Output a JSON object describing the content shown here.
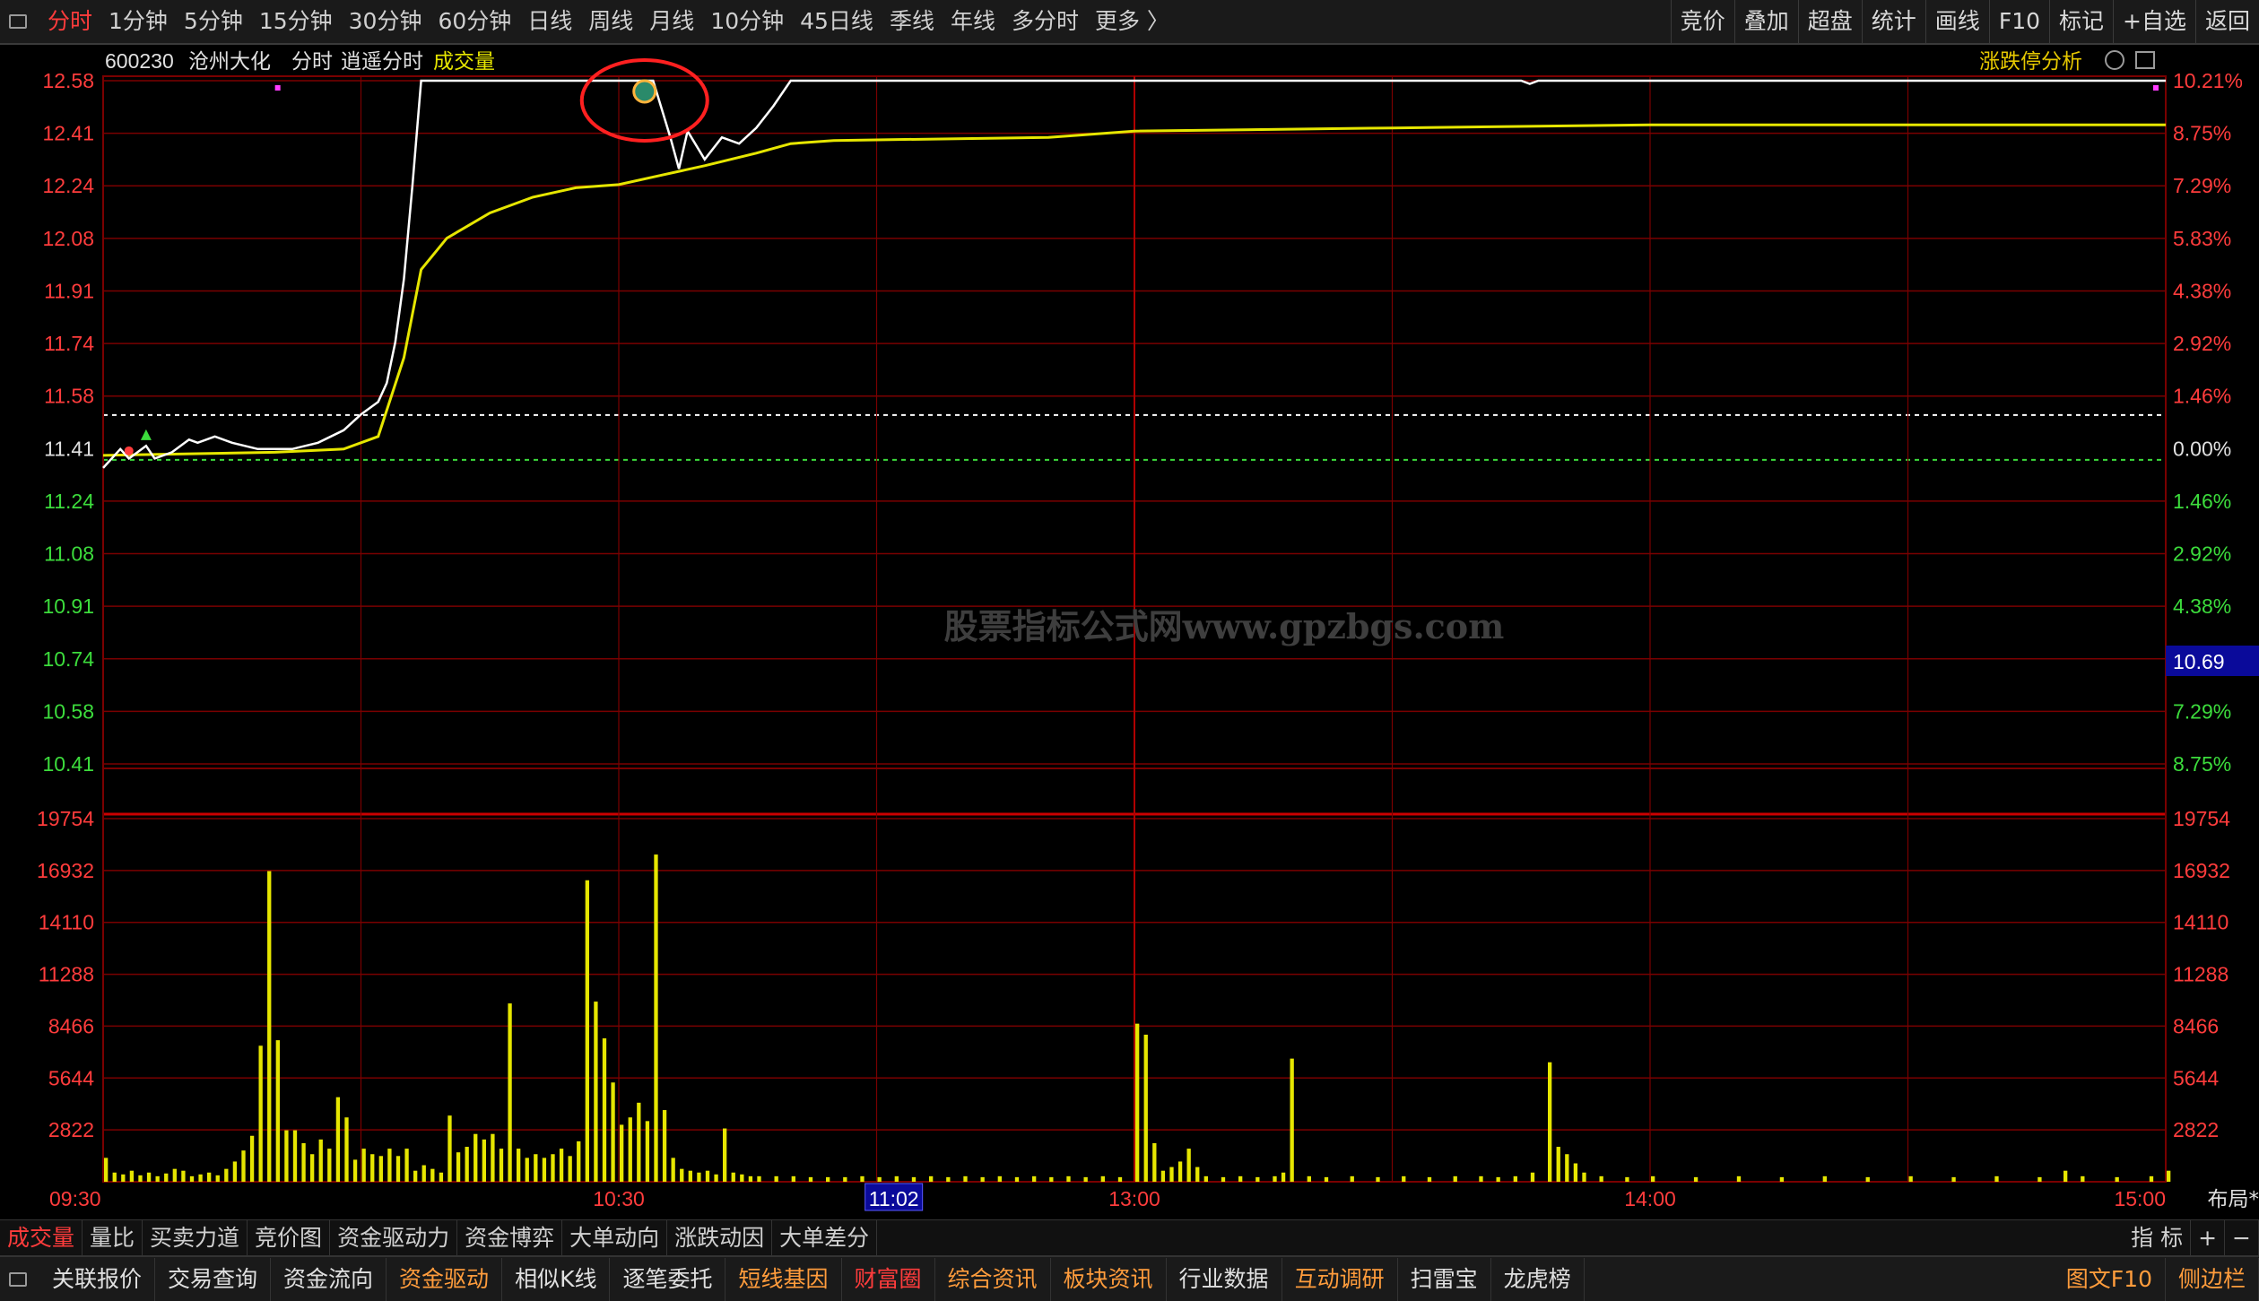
{
  "toolbar": {
    "periods": [
      "分时",
      "1分钟",
      "5分钟",
      "15分钟",
      "30分钟",
      "60分钟",
      "日线",
      "周线",
      "月线",
      "10分钟",
      "45日线",
      "季线",
      "年线",
      "多分时",
      "更多 〉"
    ],
    "tools": [
      "竞价",
      "叠加",
      "超盘",
      "统计",
      "画线",
      "F10",
      "标记",
      "+自选",
      "返回"
    ]
  },
  "header": {
    "code": "600230",
    "name": "沧州大化",
    "mode": "分时",
    "mode2": "逍遥分时",
    "indicator": "成交量",
    "right_label": "涨跌停分析"
  },
  "watermark": "股票指标公式网www.gpzbgs.com",
  "cursor_value": "10.69",
  "layout_btn": "布局*",
  "indicator_tabs": [
    "成交量",
    "量比",
    "买卖力道",
    "竞价图",
    "资金驱动力",
    "资金博弈",
    "大单动向",
    "涨跌动因",
    "大单差分"
  ],
  "indicator_tools": [
    "指 标",
    "+",
    "−"
  ],
  "bottom_tabs": [
    "关联报价",
    "交易查询",
    "资金流向",
    "资金驱动",
    "相似K线",
    "逐笔委托",
    "短线基因",
    "财富圈",
    "综合资讯",
    "板块资讯",
    "行业数据",
    "互动调研",
    "扫雷宝",
    "龙虎榜"
  ],
  "bottom_right": [
    "图文F10",
    "侧边栏"
  ],
  "colors": {
    "price_line": "#ffffff",
    "avg_line": "#e6e600",
    "volume_bar": "#e6e600",
    "up_text": "#ff3c3c",
    "down_text": "#3cdc3c",
    "grid": "#7a0000",
    "highlight_circle": "#ff2020"
  },
  "chart_data": [
    {
      "type": "line",
      "series": [],
      "price_labels": [
        "12.58",
        "12.41",
        "12.24",
        "12.08",
        "11.91",
        "11.74",
        "11.58",
        "11.41",
        "11.24",
        "11.08",
        "10.91",
        "10.74",
        "10.58",
        "10.41"
      ],
      "pct_labels": [
        "10.21%",
        "8.75%",
        "7.29%",
        "5.83%",
        "4.38%",
        "2.92%",
        "1.46%",
        "0.00%",
        "1.46%",
        "2.92%",
        "4.38%",
        "5.83%",
        "7.29%",
        "8.75%"
      ],
      "time_labels": [
        "09:30",
        "10:30",
        "11:02",
        "13:00",
        "14:00",
        "15:00"
      ],
      "cursor_time": "11:02",
      "ylim": [
        10.41,
        12.58
      ],
      "prev_close": 11.41,
      "price_series": [
        [
          0,
          11.35
        ],
        [
          2,
          11.41
        ],
        [
          3,
          11.38
        ],
        [
          5,
          11.42
        ],
        [
          6,
          11.38
        ],
        [
          8,
          11.4
        ],
        [
          10,
          11.44
        ],
        [
          11,
          11.43
        ],
        [
          13,
          11.45
        ],
        [
          15,
          11.43
        ],
        [
          18,
          11.41
        ],
        [
          22,
          11.41
        ],
        [
          25,
          11.43
        ],
        [
          28,
          11.47
        ],
        [
          30,
          11.52
        ],
        [
          32,
          11.56
        ],
        [
          33,
          11.62
        ],
        [
          34,
          11.75
        ],
        [
          35,
          11.95
        ],
        [
          36,
          12.25
        ],
        [
          37,
          12.58
        ],
        [
          60,
          12.58
        ],
        [
          64,
          12.58
        ],
        [
          66,
          12.4
        ],
        [
          67,
          12.3
        ],
        [
          68,
          12.42
        ],
        [
          70,
          12.33
        ],
        [
          72,
          12.4
        ],
        [
          74,
          12.38
        ],
        [
          76,
          12.43
        ],
        [
          78,
          12.5
        ],
        [
          80,
          12.58
        ],
        [
          165,
          12.58
        ],
        [
          166,
          12.57
        ],
        [
          167,
          12.58
        ],
        [
          240,
          12.58
        ]
      ],
      "avg_series": [
        [
          0,
          11.39
        ],
        [
          20,
          11.4
        ],
        [
          28,
          11.41
        ],
        [
          32,
          11.45
        ],
        [
          35,
          11.7
        ],
        [
          37,
          11.98
        ],
        [
          40,
          12.08
        ],
        [
          45,
          12.16
        ],
        [
          50,
          12.21
        ],
        [
          55,
          12.24
        ],
        [
          60,
          12.25
        ],
        [
          65,
          12.28
        ],
        [
          70,
          12.31
        ],
        [
          76,
          12.35
        ],
        [
          80,
          12.38
        ],
        [
          85,
          12.39
        ],
        [
          110,
          12.4
        ],
        [
          120,
          12.42
        ],
        [
          150,
          12.43
        ],
        [
          180,
          12.44
        ],
        [
          240,
          12.44
        ]
      ]
    },
    {
      "type": "bar",
      "ylim": [
        0,
        19754
      ],
      "ylabels": [
        "19754",
        "16932",
        "14110",
        "11288",
        "8466",
        "5644",
        "2822"
      ],
      "bars": [
        [
          0,
          1300
        ],
        [
          1,
          500
        ],
        [
          2,
          400
        ],
        [
          3,
          600
        ],
        [
          4,
          350
        ],
        [
          5,
          500
        ],
        [
          6,
          300
        ],
        [
          7,
          450
        ],
        [
          8,
          700
        ],
        [
          9,
          600
        ],
        [
          10,
          300
        ],
        [
          11,
          400
        ],
        [
          12,
          500
        ],
        [
          13,
          350
        ],
        [
          14,
          700
        ],
        [
          15,
          1100
        ],
        [
          16,
          1700
        ],
        [
          17,
          2500
        ],
        [
          18,
          7400
        ],
        [
          19,
          16900
        ],
        [
          20,
          7700
        ],
        [
          21,
          2800
        ],
        [
          22,
          2800
        ],
        [
          23,
          2100
        ],
        [
          24,
          1500
        ],
        [
          25,
          2300
        ],
        [
          26,
          1800
        ],
        [
          27,
          4600
        ],
        [
          28,
          3500
        ],
        [
          29,
          1200
        ],
        [
          30,
          1800
        ],
        [
          31,
          1500
        ],
        [
          32,
          1400
        ],
        [
          33,
          1800
        ],
        [
          34,
          1400
        ],
        [
          35,
          1800
        ],
        [
          36,
          600
        ],
        [
          37,
          900
        ],
        [
          38,
          700
        ],
        [
          39,
          500
        ],
        [
          40,
          3600
        ],
        [
          41,
          1600
        ],
        [
          42,
          1900
        ],
        [
          43,
          2600
        ],
        [
          44,
          2300
        ],
        [
          45,
          2600
        ],
        [
          46,
          1800
        ],
        [
          47,
          9700
        ],
        [
          48,
          1800
        ],
        [
          49,
          1300
        ],
        [
          50,
          1500
        ],
        [
          51,
          1300
        ],
        [
          52,
          1500
        ],
        [
          53,
          1800
        ],
        [
          54,
          1400
        ],
        [
          55,
          2200
        ],
        [
          56,
          16400
        ],
        [
          57,
          9800
        ],
        [
          58,
          7800
        ],
        [
          59,
          5400
        ],
        [
          60,
          3100
        ],
        [
          61,
          3500
        ],
        [
          62,
          4300
        ],
        [
          63,
          3300
        ],
        [
          64,
          17800
        ],
        [
          65,
          3900
        ],
        [
          66,
          1300
        ],
        [
          67,
          700
        ],
        [
          68,
          600
        ],
        [
          69,
          500
        ],
        [
          70,
          600
        ],
        [
          71,
          400
        ],
        [
          72,
          2900
        ],
        [
          73,
          500
        ],
        [
          74,
          400
        ],
        [
          75,
          300
        ],
        [
          76,
          300
        ],
        [
          78,
          300
        ],
        [
          80,
          300
        ],
        [
          82,
          250
        ],
        [
          84,
          250
        ],
        [
          86,
          250
        ],
        [
          88,
          300
        ],
        [
          90,
          250
        ],
        [
          92,
          300
        ],
        [
          94,
          250
        ],
        [
          96,
          300
        ],
        [
          98,
          250
        ],
        [
          100,
          300
        ],
        [
          102,
          250
        ],
        [
          104,
          300
        ],
        [
          106,
          250
        ],
        [
          108,
          300
        ],
        [
          110,
          250
        ],
        [
          112,
          300
        ],
        [
          114,
          250
        ],
        [
          116,
          300
        ],
        [
          118,
          250
        ],
        [
          120,
          8600
        ],
        [
          121,
          8000
        ],
        [
          122,
          2100
        ],
        [
          123,
          600
        ],
        [
          124,
          800
        ],
        [
          125,
          1100
        ],
        [
          126,
          1800
        ],
        [
          127,
          800
        ],
        [
          128,
          300
        ],
        [
          130,
          250
        ],
        [
          132,
          300
        ],
        [
          134,
          250
        ],
        [
          136,
          300
        ],
        [
          137,
          500
        ],
        [
          138,
          6700
        ],
        [
          140,
          300
        ],
        [
          142,
          250
        ],
        [
          145,
          300
        ],
        [
          148,
          250
        ],
        [
          151,
          300
        ],
        [
          154,
          250
        ],
        [
          157,
          300
        ],
        [
          160,
          300
        ],
        [
          162,
          250
        ],
        [
          164,
          300
        ],
        [
          166,
          500
        ],
        [
          168,
          6500
        ],
        [
          169,
          1900
        ],
        [
          170,
          1500
        ],
        [
          171,
          1000
        ],
        [
          172,
          500
        ],
        [
          174,
          300
        ],
        [
          177,
          250
        ],
        [
          180,
          300
        ],
        [
          185,
          250
        ],
        [
          190,
          300
        ],
        [
          195,
          250
        ],
        [
          200,
          300
        ],
        [
          205,
          250
        ],
        [
          210,
          300
        ],
        [
          215,
          250
        ],
        [
          220,
          300
        ],
        [
          225,
          250
        ],
        [
          228,
          600
        ],
        [
          230,
          300
        ],
        [
          234,
          250
        ],
        [
          238,
          300
        ],
        [
          240,
          600
        ]
      ]
    }
  ]
}
